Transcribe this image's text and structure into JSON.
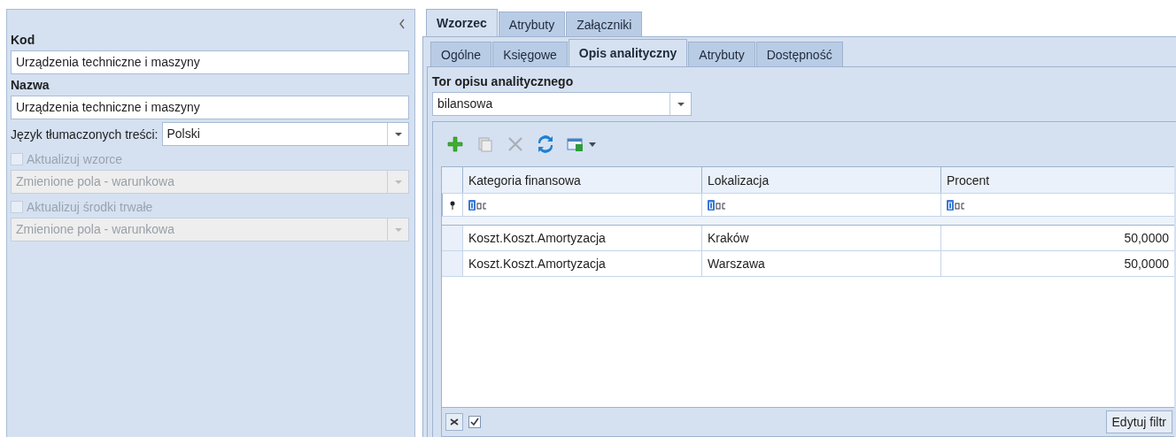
{
  "sidebar": {
    "code_label": "Kod",
    "code_value": "Urządzenia techniczne i maszyny",
    "name_label": "Nazwa",
    "name_value": "Urządzenia techniczne i maszyny",
    "language_label": "Język tłumaczonych treści:",
    "language_value": "Polski",
    "options": [
      {
        "label": "Aktualizuj wzorce",
        "checked": false,
        "disabled": true,
        "mode": "Zmienione pola - warunkowa"
      },
      {
        "label": "Aktualizuj środki trwałe",
        "checked": false,
        "disabled": true,
        "mode": "Zmienione pola - warunkowa"
      }
    ]
  },
  "tabs": [
    {
      "label": "Wzorzec",
      "selected": true
    },
    {
      "label": "Atrybuty",
      "selected": false
    },
    {
      "label": "Załączniki",
      "selected": false
    }
  ],
  "subtabs": [
    {
      "label": "Ogólne",
      "selected": false
    },
    {
      "label": "Księgowe",
      "selected": false
    },
    {
      "label": "Opis analityczny",
      "selected": true
    },
    {
      "label": "Atrybuty",
      "selected": false
    },
    {
      "label": "Dostępność",
      "selected": false
    }
  ],
  "track": {
    "label": "Tor opisu analitycznego",
    "value": "bilansowa"
  },
  "toolbar": [
    {
      "kind": "add",
      "disabled": false
    },
    {
      "kind": "copy",
      "disabled": true
    },
    {
      "kind": "delete",
      "disabled": true
    },
    {
      "kind": "refresh",
      "disabled": false
    },
    {
      "kind": "export",
      "disabled": false
    }
  ],
  "table": {
    "columns": [
      {
        "label": "Kategoria finansowa"
      },
      {
        "label": "Lokalizacja"
      },
      {
        "label": "Procent"
      }
    ],
    "rows": [
      [
        "Koszt.Koszt.Amortyzacja",
        "Kraków",
        "50,0000"
      ],
      [
        "Koszt.Koszt.Amortyzacja",
        "Warszawa",
        "50,0000"
      ]
    ]
  },
  "footer": {
    "filter_enabled": true,
    "button": "Edytuj filtr"
  }
}
